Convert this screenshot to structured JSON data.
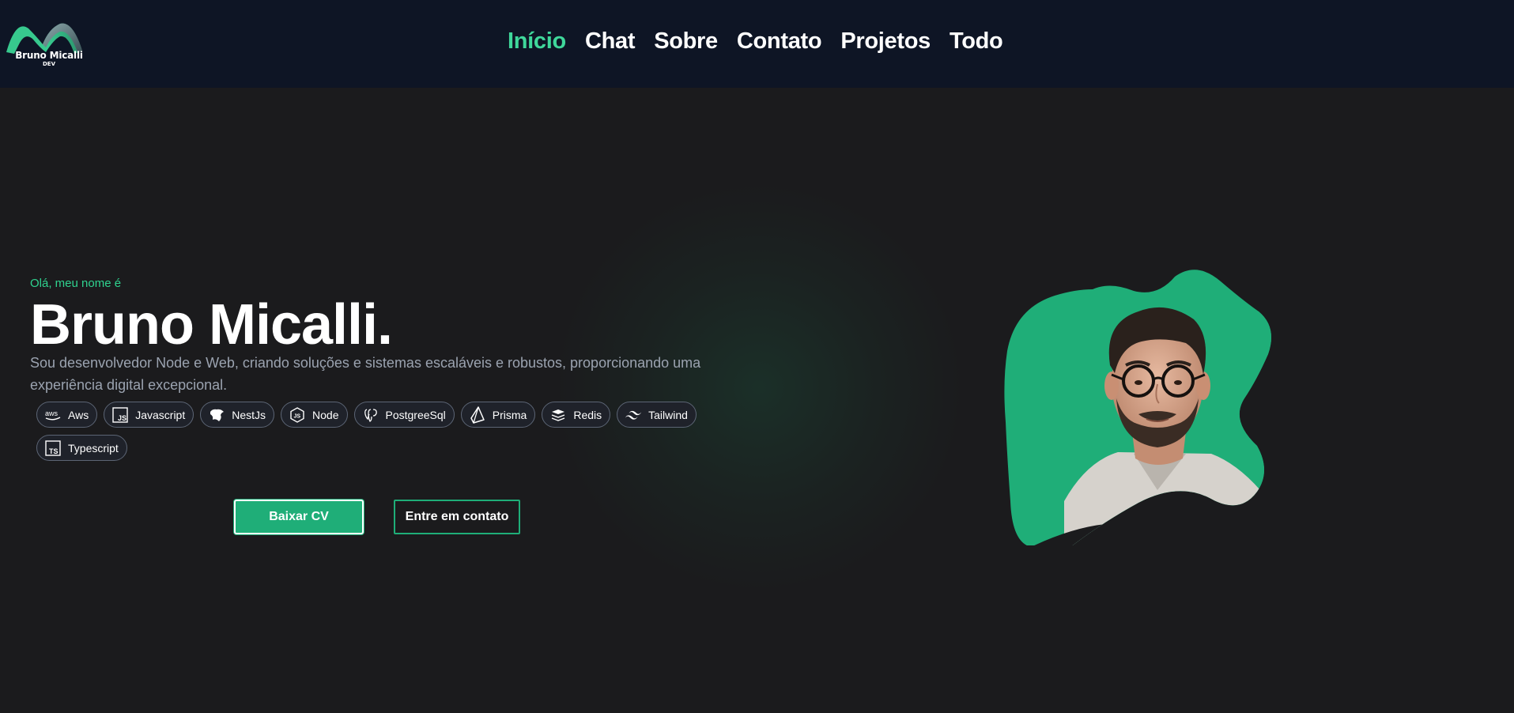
{
  "header": {
    "logo": {
      "name": "Bruno Micalli",
      "sub": "DEV"
    },
    "nav": [
      {
        "label": "Início",
        "active": true
      },
      {
        "label": "Chat",
        "active": false
      },
      {
        "label": "Sobre",
        "active": false
      },
      {
        "label": "Contato",
        "active": false
      },
      {
        "label": "Projetos",
        "active": false
      },
      {
        "label": "Todo",
        "active": false
      }
    ]
  },
  "hero": {
    "greeting": "Olá, meu nome é",
    "name": "Bruno Micalli.",
    "description": "Sou desenvolvedor Node e Web, criando soluções e sistemas escaláveis e robustos, proporcionando uma experiência digital excepcional.",
    "tags": [
      {
        "label": "Aws",
        "icon": "aws-icon"
      },
      {
        "label": "Javascript",
        "icon": "javascript-icon"
      },
      {
        "label": "NestJs",
        "icon": "nestjs-icon"
      },
      {
        "label": "Node",
        "icon": "node-icon"
      },
      {
        "label": "PostgreeSql",
        "icon": "postgresql-icon"
      },
      {
        "label": "Prisma",
        "icon": "prisma-icon"
      },
      {
        "label": "Redis",
        "icon": "redis-icon"
      },
      {
        "label": "Tailwind",
        "icon": "tailwind-icon"
      },
      {
        "label": "Typescript",
        "icon": "typescript-icon"
      }
    ],
    "buttons": {
      "cv": "Baixar CV",
      "contact": "Entre em contato"
    }
  },
  "colors": {
    "accent": "#3fd79b",
    "button": "#1fae78",
    "header_bg": "#0e1525",
    "page_bg": "#1b1b1d",
    "blob": "#1fae78"
  }
}
